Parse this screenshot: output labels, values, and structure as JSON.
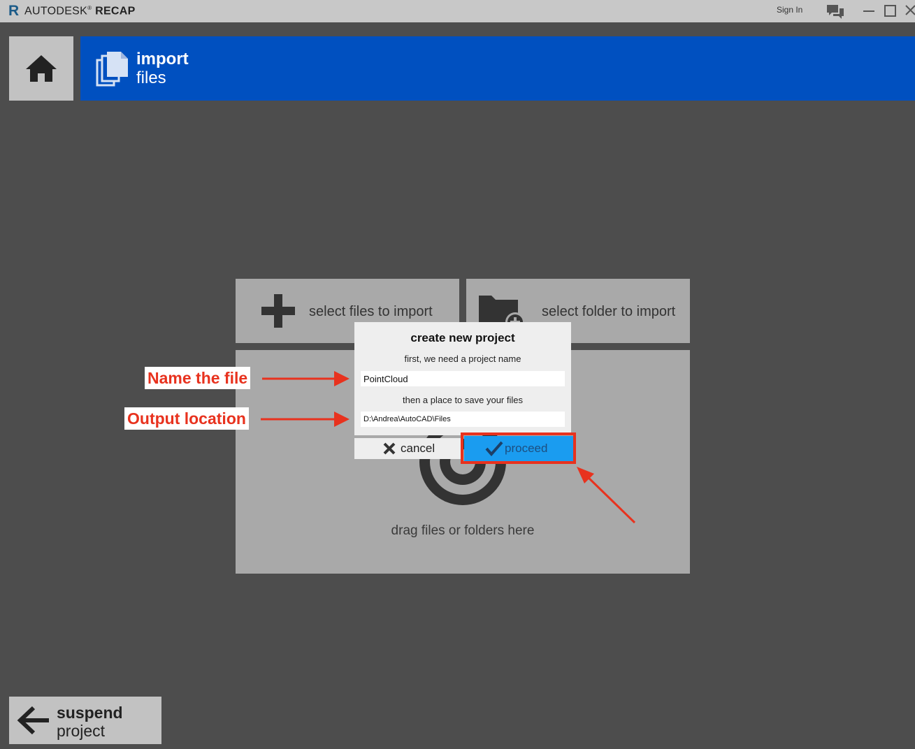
{
  "titlebar": {
    "logo_letter": "R",
    "brand_light": "AUTODESK",
    "brand_reg": "®",
    "brand_bold": "RECAP",
    "sign_in": "Sign In"
  },
  "header": {
    "title": "import",
    "subtitle": "files",
    "accent_color": "#0050c0"
  },
  "tiles": {
    "select_files": "select files to import",
    "select_folder": "select folder to import",
    "drop_label": "drag files or folders here"
  },
  "dialog": {
    "title": "create new project",
    "prompt_name": "first, we need a project name",
    "project_name": "PointCloud",
    "prompt_location": "then a place to save your files",
    "save_location": "D:\\Andrea\\AutoCAD\\Files",
    "cancel_label": "cancel",
    "proceed_label": "proceed",
    "proceed_color": "#1a9cf0"
  },
  "annotations": {
    "name_label": "Name the file",
    "output_label": "Output location",
    "color": "#e8321e"
  },
  "footer": {
    "suspend_title": "suspend",
    "suspend_sub": "project"
  }
}
